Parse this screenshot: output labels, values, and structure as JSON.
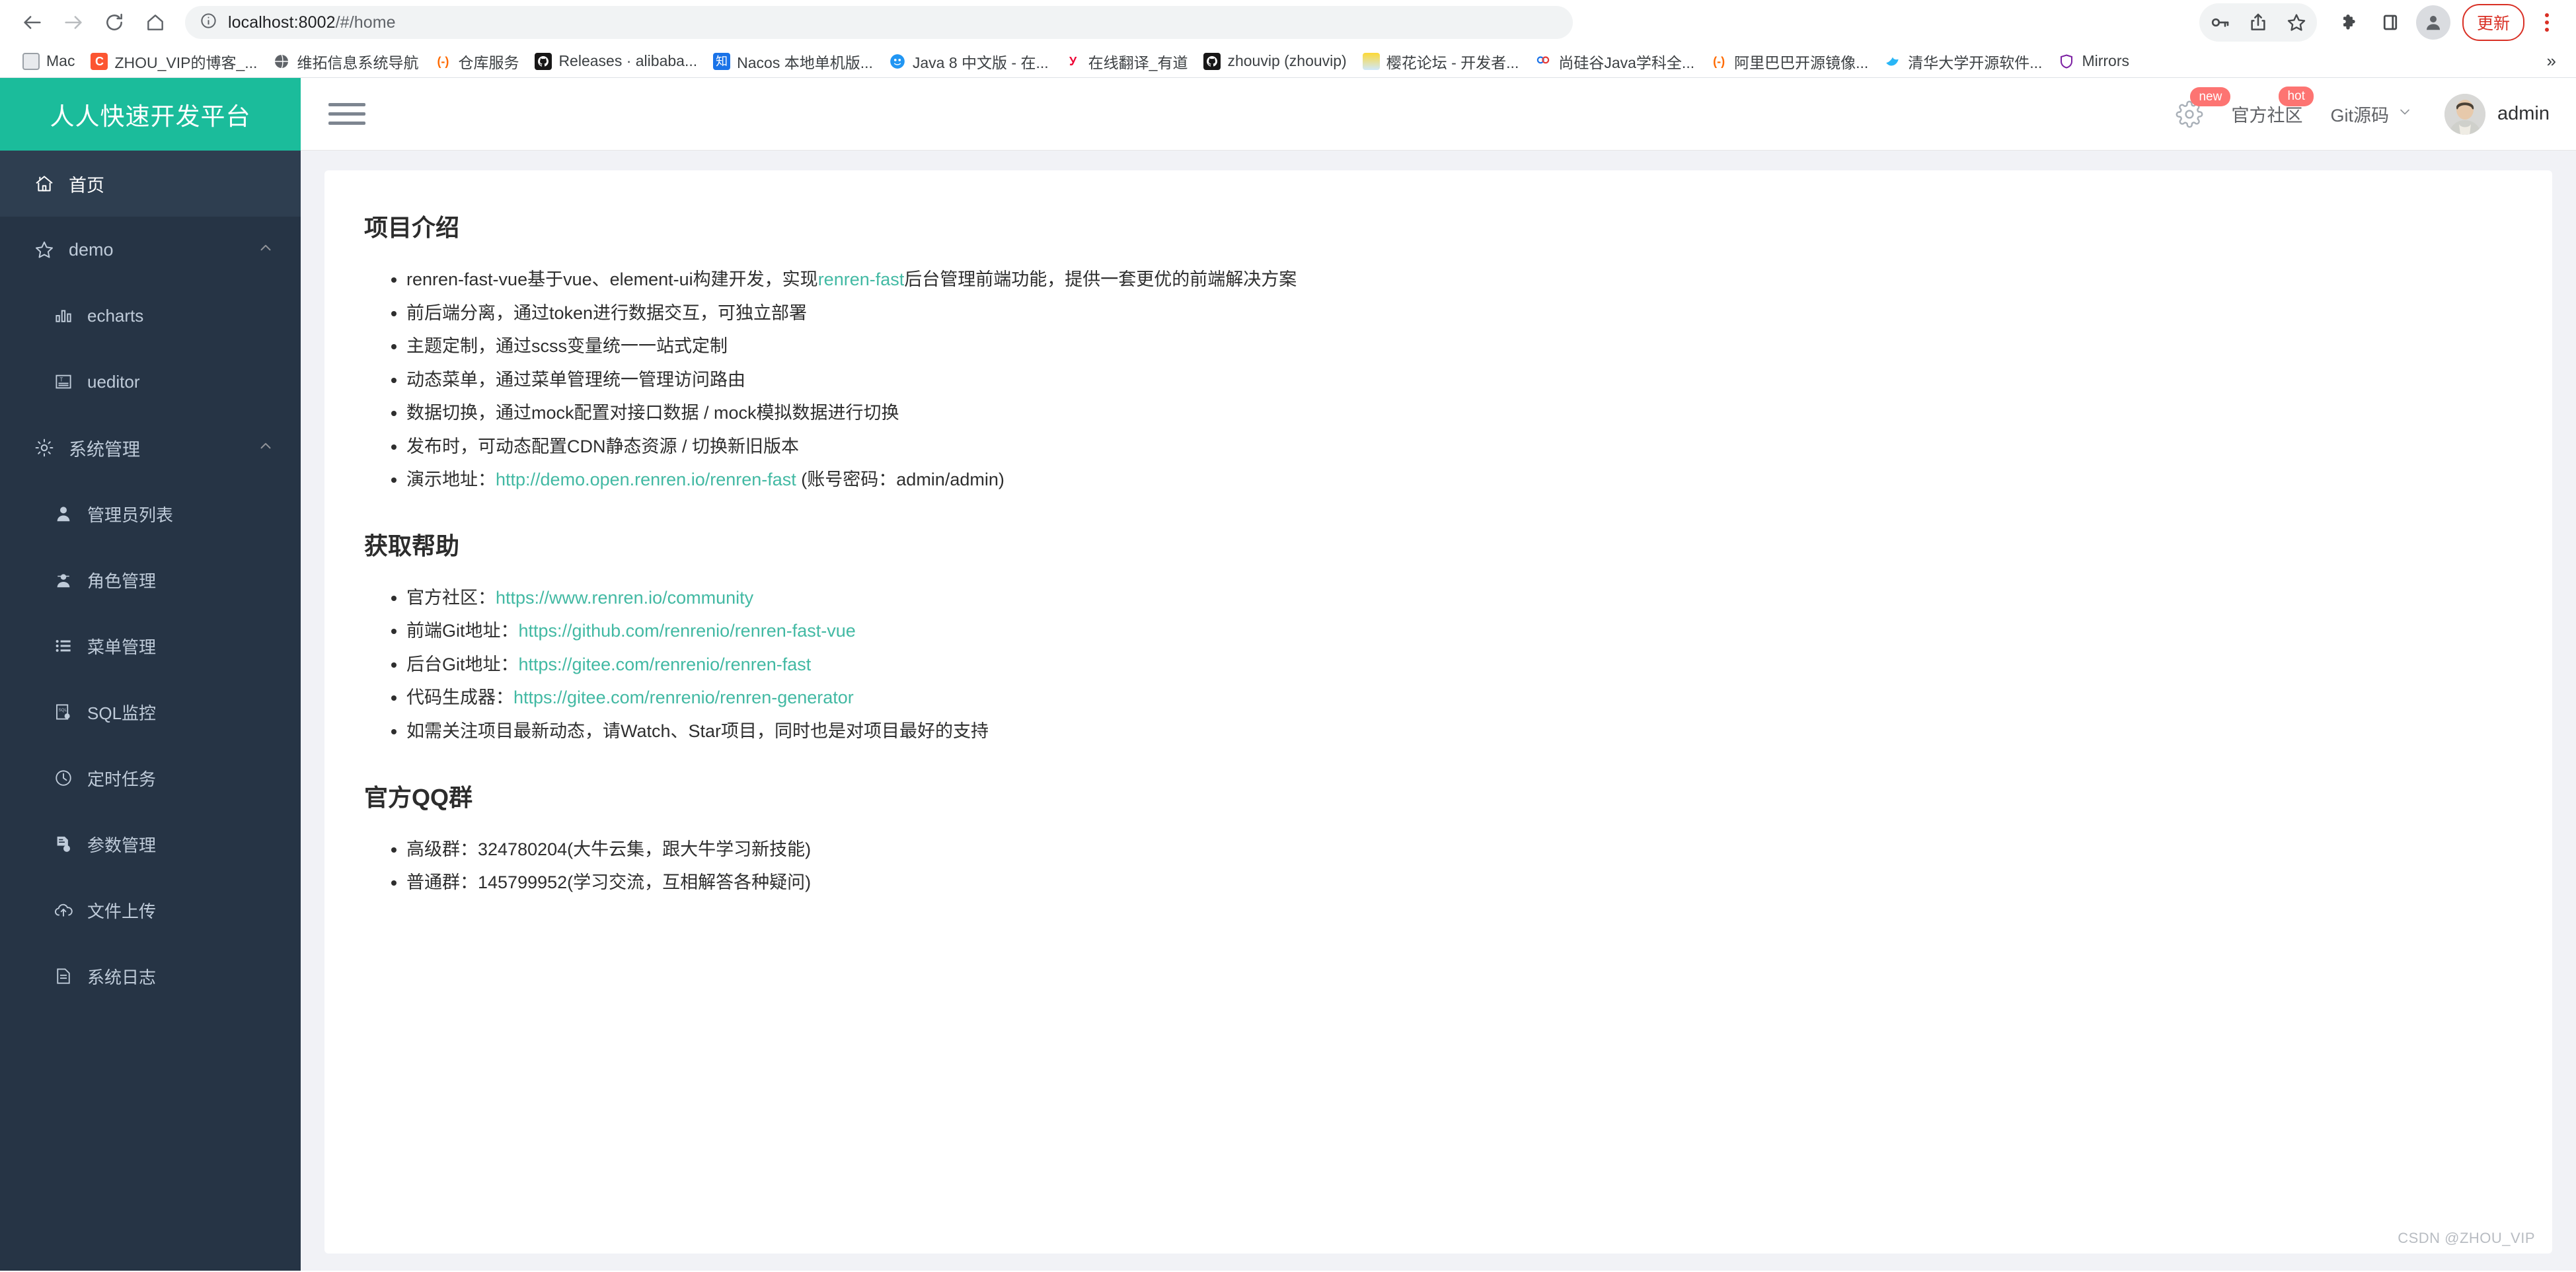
{
  "browser": {
    "nav": {
      "back": "back-arrow",
      "forward": "forward-arrow",
      "reload": "reload",
      "home": "home"
    },
    "omnibox": {
      "info_icon": "info-circle-icon",
      "url_host": "localhost:8002",
      "url_path": "/#/home",
      "url_full": "localhost:8002/#/home"
    },
    "toolbar_icons": [
      "key-icon",
      "share-icon",
      "star-icon",
      "extensions-icon",
      "sidepanel-icon",
      "profile-icon"
    ],
    "update_button": "更新",
    "menu_icon": "kebab-menu-icon",
    "bookmarks": [
      {
        "label": "Mac",
        "icon": "folder-icon"
      },
      {
        "label": "ZHOU_VIP的博客_...",
        "icon": "csdn-icon"
      },
      {
        "label": "维拓信息系统导航",
        "icon": "globe-icon"
      },
      {
        "label": "仓库服务",
        "icon": "gitlab-icon"
      },
      {
        "label": "Releases · alibaba...",
        "icon": "github-icon"
      },
      {
        "label": "Nacos 本地单机版...",
        "icon": "zhihu-icon"
      },
      {
        "label": "Java 8 中文版 - 在...",
        "icon": "java-doc-icon"
      },
      {
        "label": "在线翻译_有道",
        "icon": "youdao-icon"
      },
      {
        "label": "zhouvip (zhouvip)",
        "icon": "github-icon"
      },
      {
        "label": "樱花论坛 - 开发者...",
        "icon": "sakura-icon"
      },
      {
        "label": "尚硅谷Java学科全...",
        "icon": "atguigu-icon"
      },
      {
        "label": "阿里巴巴开源镜像...",
        "icon": "gitlab-icon"
      },
      {
        "label": "清华大学开源软件...",
        "icon": "tuna-icon"
      },
      {
        "label": "Mirrors",
        "icon": "shield-icon"
      }
    ],
    "bookmarks_overflow": "»"
  },
  "app": {
    "logo": "人人快速开发平台",
    "hamburger": "hamburger-icon",
    "topbar": {
      "gear_badge": "new",
      "community_label": "官方社区",
      "community_badge": "hot",
      "git_label": "Git源码",
      "git_caret": "chevron-down-icon",
      "user_name": "admin"
    },
    "sidebar": [
      {
        "label": "首页",
        "icon": "house-icon",
        "level": 1,
        "active": true,
        "arrow": ""
      },
      {
        "label": "demo",
        "icon": "star-icon",
        "level": 1,
        "active": false,
        "arrow": "⌃"
      },
      {
        "label": "echarts",
        "icon": "bar-chart-icon",
        "level": 2,
        "active": false,
        "arrow": ""
      },
      {
        "label": "ueditor",
        "icon": "text-editor-icon",
        "level": 2,
        "active": false,
        "arrow": ""
      },
      {
        "label": "系统管理",
        "icon": "gear-icon",
        "level": 1,
        "active": false,
        "arrow": "⌃"
      },
      {
        "label": "管理员列表",
        "icon": "user-icon",
        "level": 2,
        "active": false,
        "arrow": ""
      },
      {
        "label": "角色管理",
        "icon": "agent-icon",
        "level": 2,
        "active": false,
        "arrow": ""
      },
      {
        "label": "菜单管理",
        "icon": "list-icon",
        "level": 2,
        "active": false,
        "arrow": ""
      },
      {
        "label": "SQL监控",
        "icon": "sql-monitor-icon",
        "level": 2,
        "active": false,
        "arrow": ""
      },
      {
        "label": "定时任务",
        "icon": "clock-icon",
        "level": 2,
        "active": false,
        "arrow": ""
      },
      {
        "label": "参数管理",
        "icon": "document-gear-icon",
        "level": 2,
        "active": false,
        "arrow": ""
      },
      {
        "label": "文件上传",
        "icon": "cloud-upload-icon",
        "level": 2,
        "active": false,
        "arrow": ""
      },
      {
        "label": "系统日志",
        "icon": "document-icon",
        "level": 2,
        "active": false,
        "arrow": ""
      }
    ]
  },
  "content": {
    "section1_title": "项目介绍",
    "s1_b1_a": "renren-fast-vue基于vue、element-ui构建开发，实现",
    "s1_b1_link": "renren-fast",
    "s1_b1_b": "后台管理前端功能，提供一套更优的前端解决方案",
    "s1_b2": "前后端分离，通过token进行数据交互，可独立部署",
    "s1_b3": "主题定制，通过scss变量统一一站式定制",
    "s1_b4": "动态菜单，通过菜单管理统一管理访问路由",
    "s1_b5": "数据切换，通过mock配置对接口数据 / mock模拟数据进行切换",
    "s1_b6": "发布时，可动态配置CDN静态资源 / 切换新旧版本",
    "s1_b7_pre": "演示地址：",
    "s1_b7_link": "http://demo.open.renren.io/renren-fast",
    "s1_b7_post": "(账号密码：admin/admin)",
    "section2_title": "获取帮助",
    "s2_b1_pre": "官方社区：",
    "s2_b1_link": "https://www.renren.io/community",
    "s2_b2_pre": "前端Git地址：",
    "s2_b2_link": "https://github.com/renrenio/renren-fast-vue",
    "s2_b3_pre": "后台Git地址：",
    "s2_b3_link": "https://gitee.com/renrenio/renren-fast",
    "s2_b4_pre": "代码生成器：",
    "s2_b4_link": "https://gitee.com/renrenio/renren-generator",
    "s2_b5": "如需关注项目最新动态，请Watch、Star项目，同时也是对项目最好的支持",
    "section3_title": "官方QQ群",
    "s3_b1": "高级群：324780204(大牛云集，跟大牛学习新技能)",
    "s3_b2": "普通群：145799952(学习交流，互相解答各种疑问)",
    "watermark": "CSDN @ZHOU_VIP"
  },
  "colors": {
    "brand_teal": "#1bbc9b",
    "link_teal": "#42b9a3",
    "sidebar_bg": "#263445",
    "sidebar_active": "#2e3e50",
    "badge_red": "#fd7472",
    "update_red": "#d93025"
  }
}
